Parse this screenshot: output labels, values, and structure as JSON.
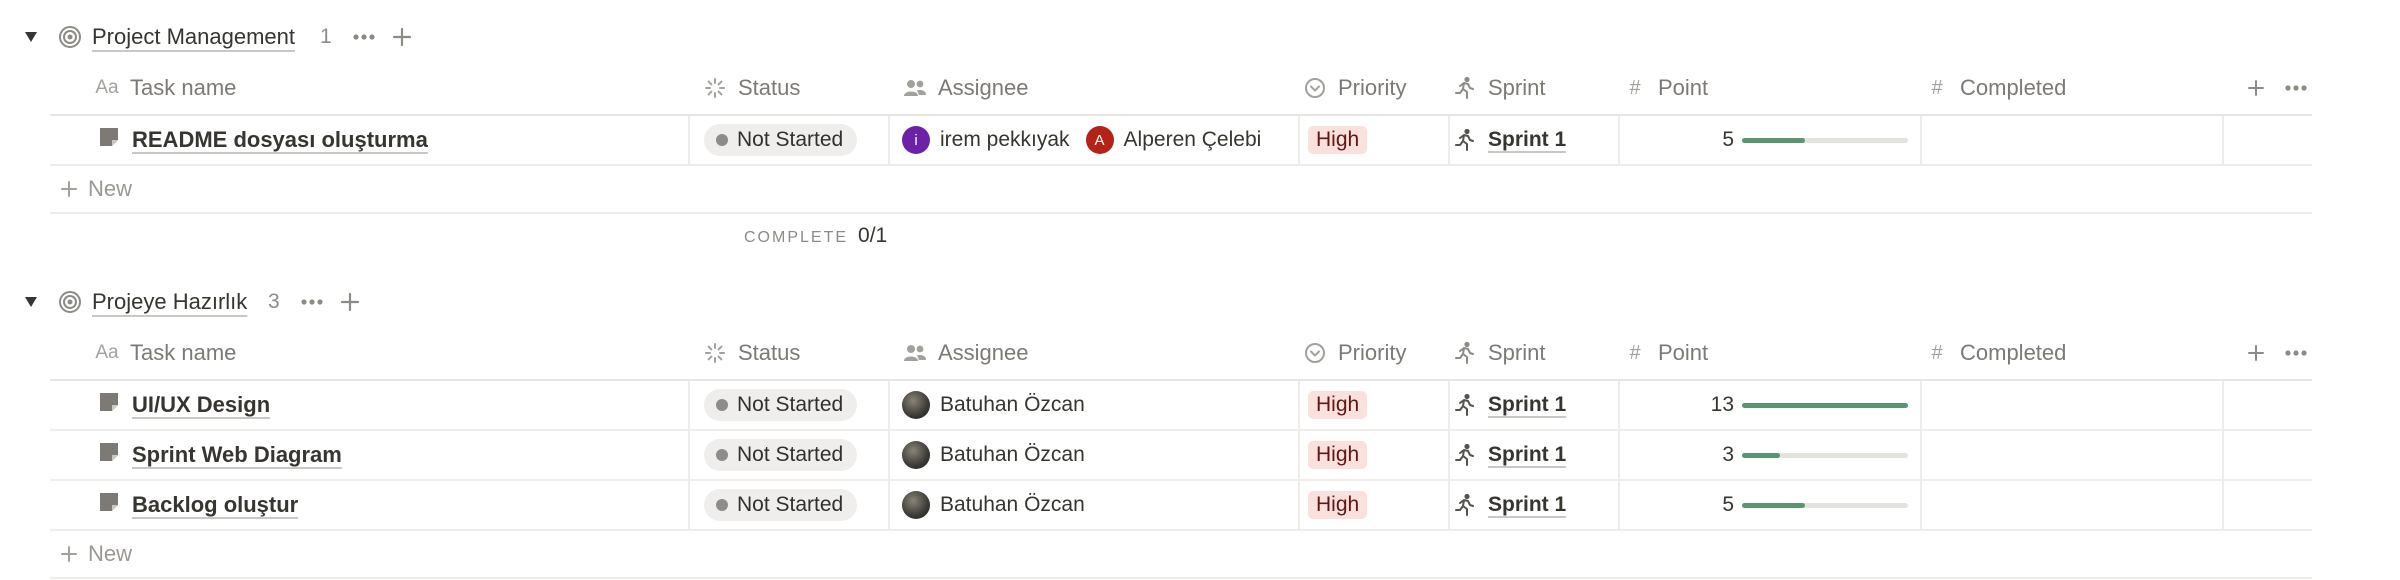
{
  "columns": {
    "task_name": "Task name",
    "status": "Status",
    "assignee": "Assignee",
    "priority": "Priority",
    "sprint": "Sprint",
    "point": "Point",
    "completed": "Completed"
  },
  "new_label": "New",
  "groups": [
    {
      "title": "Project Management",
      "count": "1",
      "summary": {
        "label": "COMPLETE",
        "value": "0/1"
      },
      "rows": [
        {
          "task": "README dosyası oluşturma",
          "status": "Not Started",
          "assignees": [
            {
              "initial": "i",
              "name": "irem pekkıyak",
              "color": "#6b21a8"
            },
            {
              "initial": "A",
              "name": "Alperen Çelebi",
              "color": "#b42318"
            }
          ],
          "priority": "High",
          "sprint": "Sprint 1",
          "point": "5",
          "point_fraction": 0.38
        }
      ]
    },
    {
      "title": "Projeye Hazırlık",
      "count": "3",
      "rows": [
        {
          "task": "UI/UX Design",
          "status": "Not Started",
          "assignees": [
            {
              "initial": "",
              "name": "Batuhan Özcan",
              "color": "#3b3a36"
            }
          ],
          "priority": "High",
          "sprint": "Sprint 1",
          "point": "13",
          "point_fraction": 1.0
        },
        {
          "task": "Sprint Web Diagram",
          "status": "Not Started",
          "assignees": [
            {
              "initial": "",
              "name": "Batuhan Özcan",
              "color": "#3b3a36"
            }
          ],
          "priority": "High",
          "sprint": "Sprint 1",
          "point": "3",
          "point_fraction": 0.23
        },
        {
          "task": "Backlog oluştur",
          "status": "Not Started",
          "assignees": [
            {
              "initial": "",
              "name": "Batuhan Özcan",
              "color": "#3b3a36"
            }
          ],
          "priority": "High",
          "sprint": "Sprint 1",
          "point": "5",
          "point_fraction": 0.38
        }
      ]
    }
  ],
  "icons": {
    "toggle": "triangle-down-icon",
    "group": "target-icon",
    "task": "page-icon",
    "status": "loading-icon",
    "assignee": "people-icon",
    "priority": "chevron-circle-icon",
    "sprint": "runner-icon",
    "point": "hash-icon",
    "add": "plus-icon",
    "more": "ellipsis-icon"
  }
}
